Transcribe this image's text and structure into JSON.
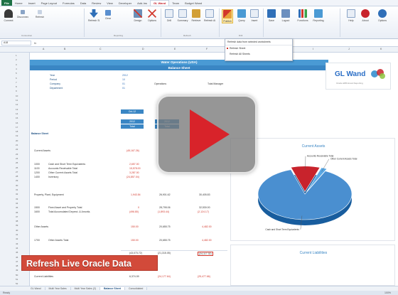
{
  "ribbon": {
    "file_tab": "File",
    "tabs": [
      "Home",
      "Insert",
      "Page Layout",
      "Formulas",
      "Data",
      "Review",
      "View",
      "Developer",
      "Add-Ins",
      "GL Wand",
      "Team",
      "Budget Wand"
    ],
    "active_tab": "GL Wand",
    "buttons": [
      "Connect",
      "Disconnect",
      "Refresh",
      "Refresh Sheet",
      "Clear",
      "Design",
      "Options",
      "Drill",
      "Summary",
      "Retrieve",
      "Refresh All",
      "Publish",
      "Query",
      "Insert",
      "Save",
      "Logout",
      "Help",
      "About"
    ],
    "group_labels": [
      "Connection",
      "Reporting",
      "Refresh",
      "Drill",
      "Functions",
      "Options"
    ]
  },
  "dropdown": {
    "title": "Refresh data from selected worksheets",
    "items": [
      "Refresh Sheet",
      "Refresh All Sheets"
    ],
    "selected_index": 0
  },
  "formula_bar": {
    "name_box": "A18",
    "fx": "fx",
    "content": ""
  },
  "sheet": {
    "title": "Water Operations (USA)",
    "subtitle": "Balance Sheet",
    "header_labels": [
      {
        "label": "Year",
        "value": "2012"
      },
      {
        "label": "Period",
        "value": "10"
      },
      {
        "label": "Company",
        "value": "01"
      },
      {
        "label": "Department",
        "value": "01"
      }
    ],
    "col_tags": [
      "Operations",
      "Total Manager"
    ],
    "section_tag": "Balance Sheet",
    "period_boxes": [
      "Oct-12",
      "2012",
      "Total"
    ],
    "rows": [
      {
        "code": "",
        "label": "Current Assets",
        "v1": "(45,167.26)",
        "v2": "",
        "v3": ""
      },
      {
        "code": "1000",
        "label": "Cash and Short Term Equivalents",
        "v1": "2,657.00",
        "v2": "",
        "v3": ""
      },
      {
        "code": "1100",
        "label": "Accounts Receivable Total",
        "v1": "15,578.00",
        "v2": "",
        "v3": ""
      },
      {
        "code": "1200",
        "label": "Other Current Assets Total",
        "v1": "3,287.00",
        "v2": "",
        "v3": ""
      },
      {
        "code": "1400",
        "label": "Inventory",
        "v1": "(24,857.04)",
        "v2": "",
        "v3": ""
      },
      {
        "code": "",
        "label": "Property, Plant, Equipment",
        "v1": "1,943.54",
        "v2": "26,901.62",
        "v3": "30,405.83"
      },
      {
        "code": "1500",
        "label": "Fixed Asset and Property Total",
        "v1": "0",
        "v2": "28,795.06",
        "v3": "32,530.00"
      },
      {
        "code": "1600",
        "label": "Total Accumulated Depreci. & Amortiz.",
        "v1": "(496.80)",
        "v2": "(1,893.44)",
        "v3": "(2,124.17)"
      },
      {
        "code": "",
        "label": "Other Assets",
        "v1": "150.00",
        "v2": "20,655.75",
        "v3": "4,482.00"
      },
      {
        "code": "1700",
        "label": "Other Assets Total",
        "v1": "150.00",
        "v2": "20,655.75",
        "v3": "4,482.00"
      },
      {
        "code": "",
        "label": "Current Liabilities",
        "v1": "6,374.09",
        "v2": "(24,177.64)",
        "v3": "(25,477.66)"
      }
    ],
    "total_row": {
      "v1": "(43,073.72)",
      "v2": "(21,315.05)",
      "v3": "(24,117.32)"
    }
  },
  "logo": {
    "text": "GL Wand",
    "tagline": "Oracle EBS Excel Reporting"
  },
  "chart": {
    "title": "Current Assets"
  },
  "chart2": {
    "title": "Current Liabilities"
  },
  "chart_data": {
    "type": "pie",
    "title": "Current Assets",
    "categories": [
      "Cash and Short Term Equivalents",
      "Accounts Receivable Total",
      "Other Current Assets Total"
    ],
    "values": [
      88,
      10,
      2
    ],
    "colors": [
      "#4a8fd0",
      "#c8232c",
      "#5aa9e6"
    ]
  },
  "overlay": {
    "caption": "Refresh Live Oracle Data"
  },
  "sheet_tabs": [
    "GL Wand",
    "Multi Year Sales",
    "Multi Year Sales (2)",
    "Balance Sheet",
    "Consolidated"
  ],
  "active_sheet_tab": "Balance Sheet",
  "status": {
    "left": "Ready",
    "zoom": "100%"
  }
}
